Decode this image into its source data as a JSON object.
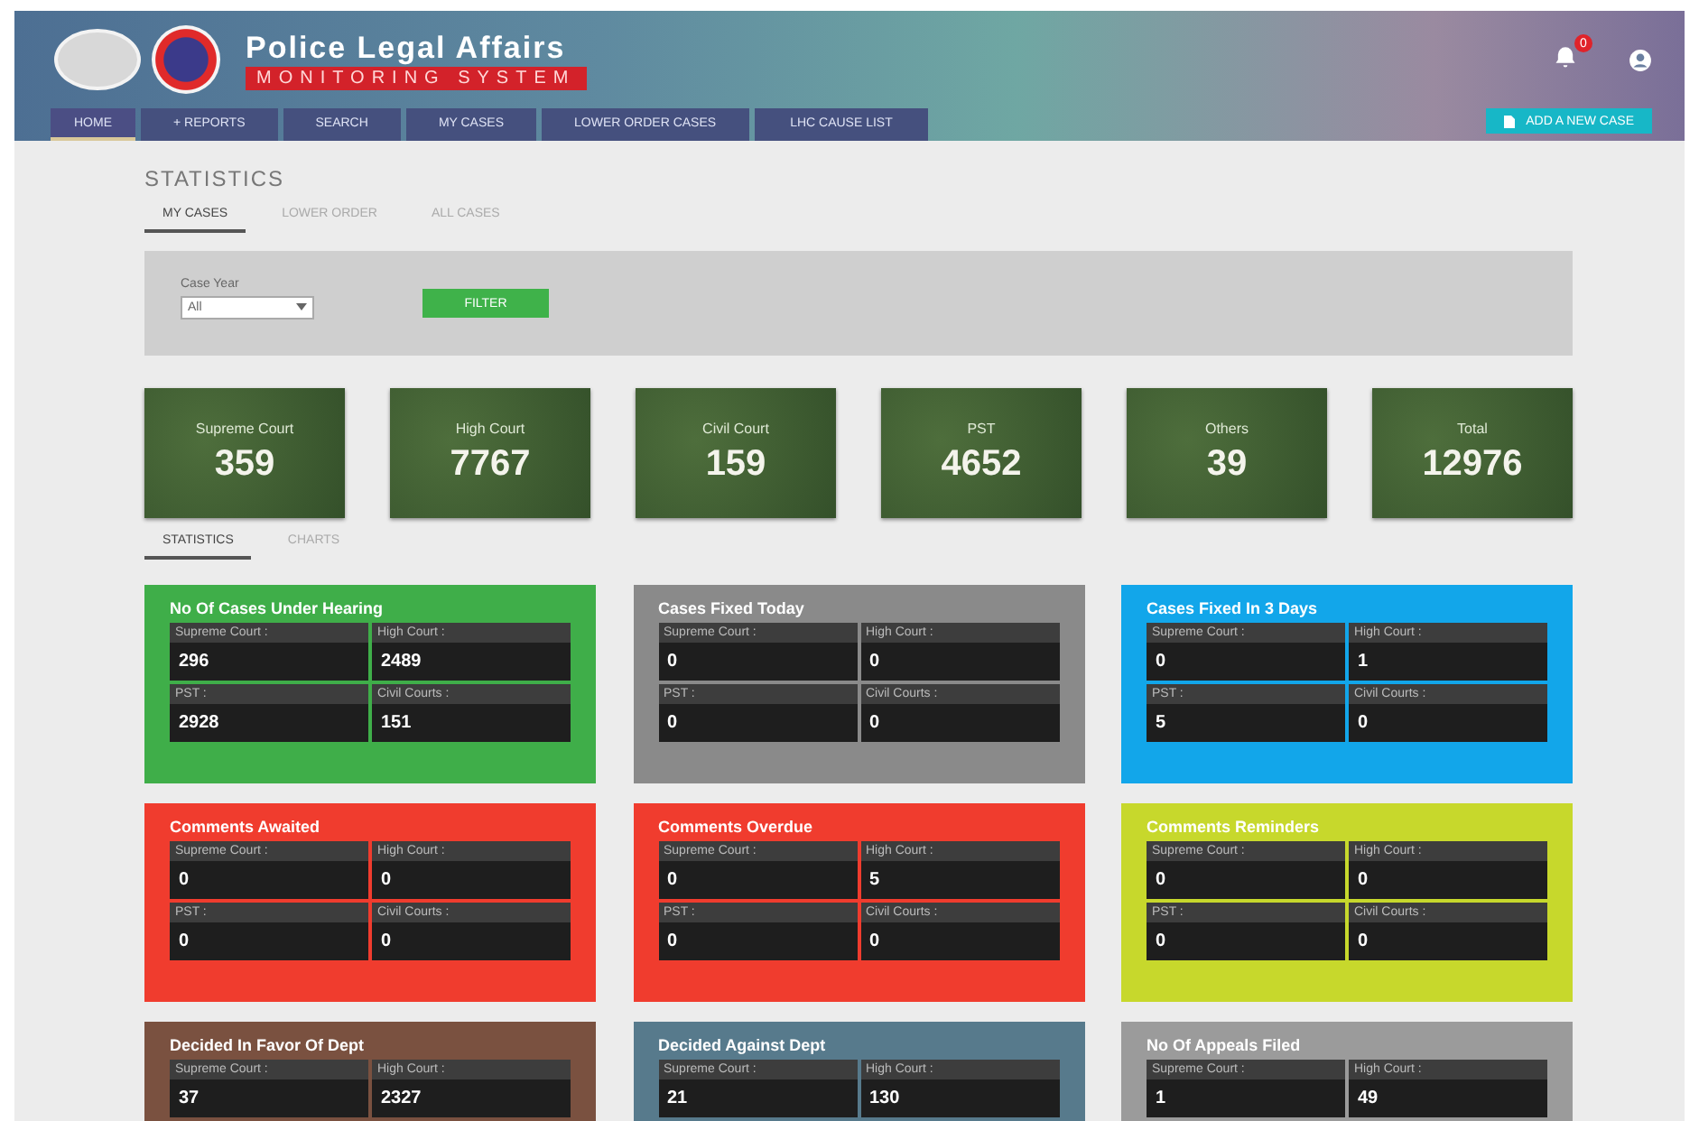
{
  "header": {
    "title": "Police Legal Affairs",
    "subtitle": "MONITORING SYSTEM",
    "notification_count": "0"
  },
  "nav": [
    {
      "label": "HOME",
      "selected": true
    },
    {
      "label": "+ REPORTS",
      "selected": false
    },
    {
      "label": "SEARCH",
      "selected": false
    },
    {
      "label": "MY CASES",
      "selected": false
    },
    {
      "label": "LOWER ORDER CASES",
      "selected": false
    },
    {
      "label": "LHC CAUSE LIST",
      "selected": false
    }
  ],
  "add_button": "ADD A NEW CASE",
  "page_title": "STATISTICS",
  "tabs": [
    {
      "label": "MY CASES",
      "selected": true
    },
    {
      "label": "LOWER ORDER",
      "selected": false
    },
    {
      "label": "ALL CASES",
      "selected": false
    }
  ],
  "filter": {
    "label": "Case Year",
    "value": "All",
    "button": "FILTER"
  },
  "totals": [
    {
      "label": "Supreme Court",
      "value": "359"
    },
    {
      "label": "High Court",
      "value": "7767"
    },
    {
      "label": "Civil Court",
      "value": "159"
    },
    {
      "label": "PST",
      "value": "4652"
    },
    {
      "label": "Others",
      "value": "39"
    },
    {
      "label": "Total",
      "value": "12976"
    }
  ],
  "view_tabs": [
    {
      "label": "STATISTICS",
      "selected": true
    },
    {
      "label": "CHARTS",
      "selected": false
    }
  ],
  "cards": [
    {
      "title": "No Of Cases Under Hearing",
      "color": "#3fae49",
      "cells": [
        {
          "label": "Supreme Court :",
          "value": "296"
        },
        {
          "label": "High Court :",
          "value": "2489"
        },
        {
          "label": "PST :",
          "value": "2928"
        },
        {
          "label": "Civil Courts :",
          "value": "151"
        }
      ]
    },
    {
      "title": "Cases Fixed Today",
      "color": "#8a8a8a",
      "cells": [
        {
          "label": "Supreme Court :",
          "value": "0"
        },
        {
          "label": "High Court :",
          "value": "0"
        },
        {
          "label": "PST :",
          "value": "0"
        },
        {
          "label": "Civil Courts :",
          "value": "0"
        }
      ]
    },
    {
      "title": "Cases Fixed In 3 Days",
      "color": "#12a6ea",
      "cells": [
        {
          "label": "Supreme Court :",
          "value": "0"
        },
        {
          "label": "High Court :",
          "value": "1"
        },
        {
          "label": "PST :",
          "value": "5"
        },
        {
          "label": "Civil Courts :",
          "value": "0"
        }
      ]
    },
    {
      "title": "Comments Awaited",
      "color": "#f03c2e",
      "cells": [
        {
          "label": "Supreme Court :",
          "value": "0"
        },
        {
          "label": "High Court :",
          "value": "0"
        },
        {
          "label": "PST :",
          "value": "0"
        },
        {
          "label": "Civil Courts :",
          "value": "0"
        }
      ]
    },
    {
      "title": "Comments Overdue",
      "color": "#f03c2e",
      "cells": [
        {
          "label": "Supreme Court :",
          "value": "0"
        },
        {
          "label": "High Court :",
          "value": "5"
        },
        {
          "label": "PST :",
          "value": "0"
        },
        {
          "label": "Civil Courts :",
          "value": "0"
        }
      ]
    },
    {
      "title": "Comments Reminders",
      "color": "#c7d82c",
      "cells": [
        {
          "label": "Supreme Court :",
          "value": "0"
        },
        {
          "label": "High Court :",
          "value": "0"
        },
        {
          "label": "PST :",
          "value": "0"
        },
        {
          "label": "Civil Courts :",
          "value": "0"
        }
      ]
    },
    {
      "title": "Decided In Favor Of Dept",
      "color": "#7a5140",
      "cells": [
        {
          "label": "Supreme Court :",
          "value": "37"
        },
        {
          "label": "High Court :",
          "value": "2327"
        }
      ]
    },
    {
      "title": "Decided Against Dept",
      "color": "#577a8c",
      "cells": [
        {
          "label": "Supreme Court :",
          "value": "21"
        },
        {
          "label": "High Court :",
          "value": "130"
        }
      ]
    },
    {
      "title": "No Of Appeals Filed",
      "color": "#9b9b9b",
      "cells": [
        {
          "label": "Supreme Court :",
          "value": "1"
        },
        {
          "label": "High Court :",
          "value": "49"
        }
      ]
    }
  ]
}
